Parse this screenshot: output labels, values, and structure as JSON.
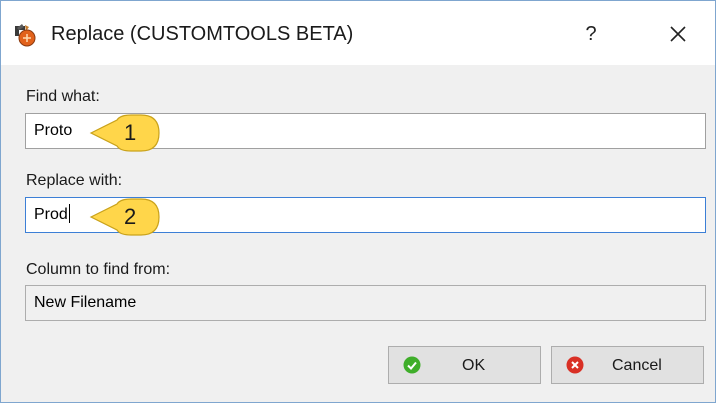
{
  "window": {
    "title": "Replace (CUSTOMTOOLS BETA)",
    "help_label": "?"
  },
  "find": {
    "label": "Find what:",
    "value": "Proto"
  },
  "replace": {
    "label": "Replace with:",
    "value": "Prod"
  },
  "column": {
    "label": "Column to find from:",
    "value": "New Filename"
  },
  "buttons": {
    "ok": "OK",
    "cancel": "Cancel"
  },
  "callouts": [
    "1",
    "2"
  ],
  "colors": {
    "callout_fill": "#ffd64a",
    "focus_border": "#3c7fd6",
    "ok_icon": "#3fae2a",
    "cancel_icon": "#d93025"
  },
  "icons": {
    "app": "customtools-app-icon",
    "close": "close-icon",
    "ok": "check-circle-icon",
    "cancel": "x-circle-icon"
  }
}
